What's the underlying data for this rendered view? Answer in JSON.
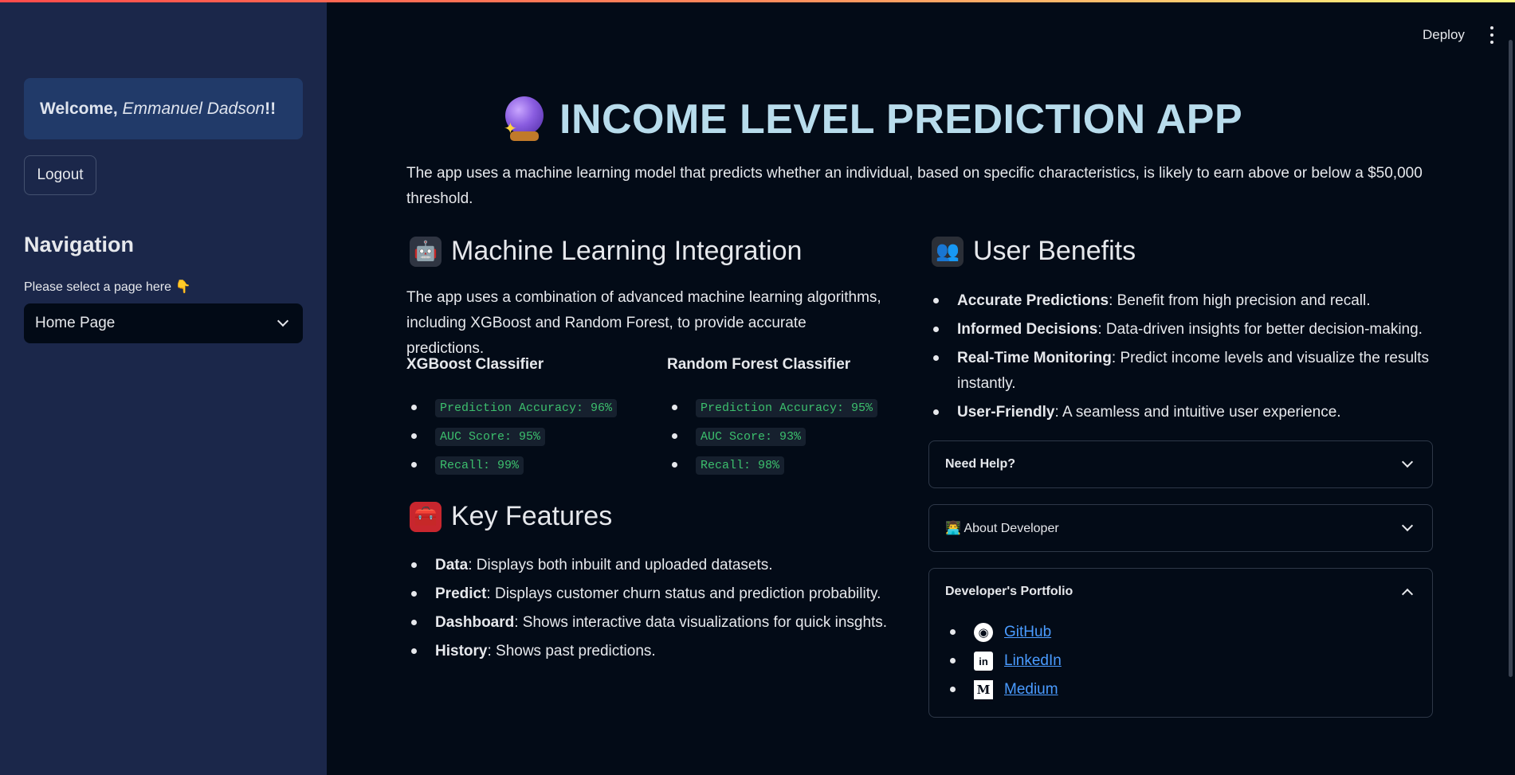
{
  "header": {
    "deploy_label": "Deploy",
    "menu_icon": "kebab-menu-icon"
  },
  "sidebar": {
    "welcome_prefix": "Welcome, ",
    "welcome_name": "Emmanuel Dadson",
    "welcome_suffix": "!!",
    "logout_label": "Logout",
    "nav_heading": "Navigation",
    "nav_hint": "Please select a page here",
    "nav_hint_icon": "pointing-down-hand-icon",
    "selected_page": "Home Page"
  },
  "main": {
    "title": "INCOME LEVEL PREDICTION APP",
    "title_icon": "crystal-ball-icon",
    "intro": "The app uses a machine learning model that predicts whether an individual, based on specific characteristics, is likely to earn above or below a $50,000 threshold.",
    "ml": {
      "heading": "Machine Learning Integration",
      "icon": "robot-icon",
      "description": "The app uses a combination of advanced machine learning algorithms, including XGBoost and Random Forest, to provide accurate predictions.",
      "xgb": {
        "title": "XGBoost Classifier",
        "metrics": [
          "Prediction Accuracy: 96%",
          "AUC Score: 95%",
          "Recall: 99%"
        ]
      },
      "rf": {
        "title": "Random Forest Classifier",
        "metrics": [
          "Prediction Accuracy: 95%",
          "AUC Score: 93%",
          "Recall: 98%"
        ]
      }
    },
    "features": {
      "heading": "Key Features",
      "icon": "toolbox-icon",
      "items": [
        {
          "term": "Data",
          "desc": ": Displays both inbuilt and uploaded datasets."
        },
        {
          "term": "Predict",
          "desc": ": Displays customer churn status and prediction probability."
        },
        {
          "term": "Dashboard",
          "desc": ": Shows interactive data visualizations for quick insghts."
        },
        {
          "term": "History",
          "desc": ": Shows past predictions."
        }
      ]
    },
    "benefits": {
      "heading": "User Benefits",
      "icon": "users-icon",
      "items": [
        {
          "term": "Accurate Predictions",
          "desc": ": Benefit from high precision and recall."
        },
        {
          "term": "Informed Decisions",
          "desc": ": Data-driven insights for better decision-making."
        },
        {
          "term": "Real-Time Monitoring",
          "desc": ": Predict income levels and visualize the results instantly."
        },
        {
          "term": "User-Friendly",
          "desc": ": A seamless and intuitive user experience."
        }
      ]
    },
    "expanders": {
      "help": "Need Help?",
      "about": "About Developer",
      "about_icon": "technologist-icon",
      "portfolio": "Developer's Portfolio",
      "links": [
        {
          "label": "GitHub",
          "icon": "github-icon"
        },
        {
          "label": "LinkedIn",
          "icon": "linkedin-icon"
        },
        {
          "label": "Medium",
          "icon": "medium-icon"
        }
      ]
    }
  }
}
